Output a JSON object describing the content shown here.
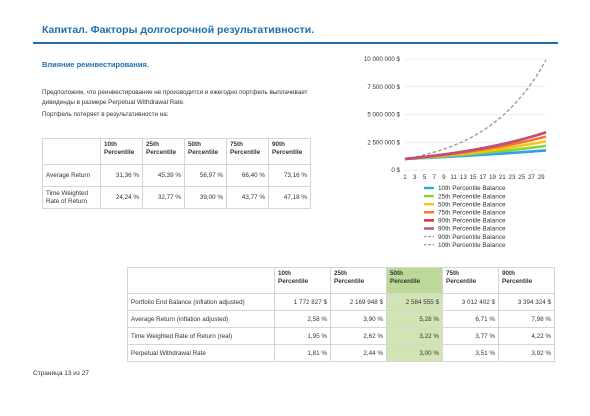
{
  "header": {
    "title": "Капитал. Факторы долгосрочной результативности."
  },
  "section": {
    "subtitle": "Влияние реинвестирования.",
    "paragraph_line1": "Предположим, что реинвестирование не производится и ежегодно портфель выплачивает",
    "paragraph_line2": "дивиденды в размере Perpetual Withdrawal Rate.",
    "paragraph2": "Портфель потеряет в результативности на:"
  },
  "loss_table": {
    "headers": [
      [
        "10th",
        "Percentile"
      ],
      [
        "25th",
        "Percentile"
      ],
      [
        "50th",
        "Percentile"
      ],
      [
        "75th",
        "Percentile"
      ],
      [
        "90th",
        "Percentile"
      ]
    ],
    "rows": [
      {
        "label": [
          "Average Return"
        ],
        "values": [
          "31,36 %",
          "45,39 %",
          "56,97 %",
          "66,40 %",
          "73,16 %"
        ]
      },
      {
        "label": [
          "Time Weighted",
          "Rate of Return"
        ],
        "values": [
          "24,24 %",
          "32,77 %",
          "39,00 %",
          "43,77 %",
          "47,18 %"
        ]
      }
    ]
  },
  "summary_table": {
    "headers": [
      [
        "10th",
        "Percentile"
      ],
      [
        "25th",
        "Percentile"
      ],
      [
        "50th",
        "Percentile"
      ],
      [
        "75th",
        "Percentile"
      ],
      [
        "90th",
        "Percentile"
      ]
    ],
    "highlight_col": 2,
    "rows": [
      {
        "label": "Portfolio End Balance (inflation adjusted)",
        "values": [
          "1 772 827 $",
          "2 169 948 $",
          "2 584 555 $",
          "3 012 402 $",
          "3 394 324 $"
        ]
      },
      {
        "label": "Average Return (inflation adjusted)",
        "values": [
          "2,58 %",
          "3,90 %",
          "5,28 %",
          "6,71 %",
          "7,98 %"
        ]
      },
      {
        "label": "Time Weighted Rate of Return (real)",
        "values": [
          "1,95 %",
          "2,62 %",
          "3,22 %",
          "3,77 %",
          "4,22 %"
        ]
      },
      {
        "label": "Perpetual Withdrawal Rate",
        "values": [
          "1,81 %",
          "2,44 %",
          "3,00 %",
          "3,51 %",
          "3,92 %"
        ]
      }
    ]
  },
  "footer": {
    "page": "Страница 13 из 27"
  },
  "chart_data": {
    "type": "line",
    "x": [
      1,
      3,
      5,
      7,
      9,
      11,
      13,
      15,
      17,
      19,
      21,
      23,
      25,
      27,
      29
    ],
    "x_tick_labels": [
      "1",
      "3",
      "5",
      "7",
      "9",
      "11",
      "13",
      "15",
      "17",
      "19",
      "21",
      "23",
      "25",
      "27",
      "29"
    ],
    "x_range": [
      1,
      30
    ],
    "y_ticks": [
      0,
      2500000,
      5000000,
      7500000,
      10000000
    ],
    "y_tick_labels": [
      "0 $",
      "2 500 000 $",
      "5 000 000 $",
      "7 500 000 $",
      "10 000 000 $"
    ],
    "ylim": [
      0,
      10000000
    ],
    "grid": true,
    "legend_position": "bottom",
    "series": [
      {
        "name": "10th Percentile Balance",
        "color": "#29a6e0",
        "dashed": false,
        "start": 1000000,
        "end": 1772827
      },
      {
        "name": "25th Percentile Balance",
        "color": "#8fcf3c",
        "dashed": false,
        "start": 1000000,
        "end": 2169948
      },
      {
        "name": "50th Percentile Balance",
        "color": "#f5c51d",
        "dashed": false,
        "start": 1000000,
        "end": 2584555
      },
      {
        "name": "75th Percentile Balance",
        "color": "#f07b22",
        "dashed": false,
        "start": 1000000,
        "end": 3012402
      },
      {
        "name": "90th Percentile Balance",
        "color": "#e3213a",
        "dashed": false,
        "start": 1000000,
        "end": 3394324
      },
      {
        "name": "90th Percentile Balance",
        "color": "#c05080",
        "dashed": false,
        "start": 1000000,
        "end": 3400000
      },
      {
        "name": "90th Percentile Balance",
        "color": "#9b9b9b",
        "dashed": true,
        "start": 1000000,
        "end": 9900000
      },
      {
        "name": "10th Percentile Balance",
        "color": "#9b9b9b",
        "dashed": true,
        "start": 1000000,
        "end": 1700000
      }
    ]
  }
}
